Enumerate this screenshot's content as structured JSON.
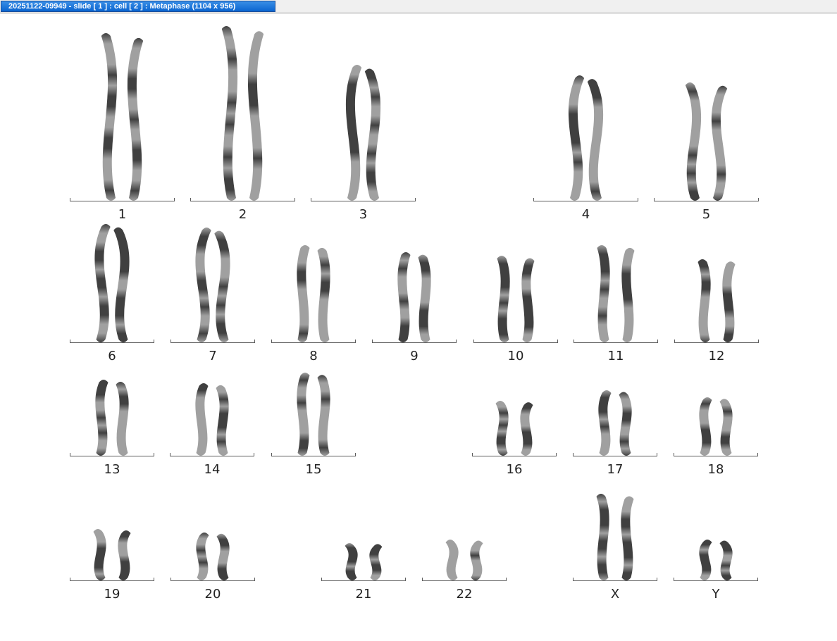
{
  "window": {
    "title": "20251122-09949 - slide [ 1 ] : cell [ 2 ] : Metaphase (1104 x 956)"
  },
  "karyogram": {
    "chromosomes": [
      {
        "label": "1"
      },
      {
        "label": "2"
      },
      {
        "label": "3"
      },
      {
        "label": "4"
      },
      {
        "label": "5"
      },
      {
        "label": "6"
      },
      {
        "label": "7"
      },
      {
        "label": "8"
      },
      {
        "label": "9"
      },
      {
        "label": "10"
      },
      {
        "label": "11"
      },
      {
        "label": "12"
      },
      {
        "label": "13"
      },
      {
        "label": "14"
      },
      {
        "label": "15"
      },
      {
        "label": "16"
      },
      {
        "label": "17"
      },
      {
        "label": "18"
      },
      {
        "label": "19"
      },
      {
        "label": "20"
      },
      {
        "label": "21"
      },
      {
        "label": "22"
      },
      {
        "label": "X"
      },
      {
        "label": "Y"
      }
    ]
  }
}
